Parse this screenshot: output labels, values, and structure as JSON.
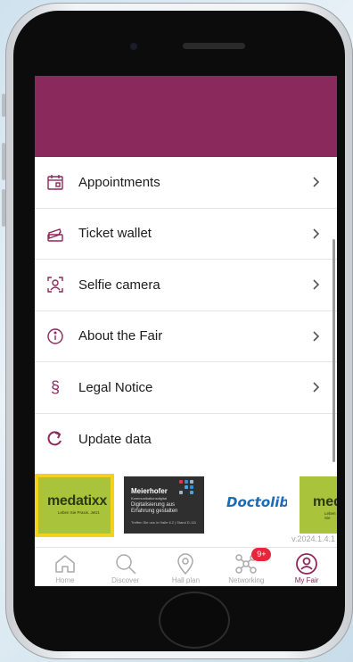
{
  "colors": {
    "brand": "#8a2a5c",
    "header": "#8a2a5c",
    "badge": "#e7253b",
    "sponsor_highlight": "#f2d21b",
    "inactive_tab": "#a9a9a9"
  },
  "menu": {
    "items": [
      {
        "label": "Appointments",
        "icon": "calendar-icon"
      },
      {
        "label": "Ticket wallet",
        "icon": "ticket-icon"
      },
      {
        "label": "Selfie camera",
        "icon": "selfie-camera-icon"
      },
      {
        "label": "About the Fair",
        "icon": "info-icon"
      },
      {
        "label": "Legal Notice",
        "icon": "section-sign-icon",
        "glyph": "§"
      },
      {
        "label": "Update data",
        "icon": "refresh-icon"
      }
    ]
  },
  "sponsors": [
    {
      "name": "medatixx",
      "tagline": "Leben Sie Praxis. Jetzt.",
      "selected": true
    },
    {
      "name": "Meierhofer",
      "line1": "Kommunikationsdigital",
      "line2": "Digitalisierung aus Erfahrung gestalten",
      "line3": "Treffen Sie uns in Halle 6.2 | Stand D-111"
    },
    {
      "name": "Doctolib"
    },
    {
      "name": "medatixx",
      "tagline": "Leben Sie"
    }
  ],
  "version": "v.2024.1.4.1",
  "tabbar": {
    "tabs": [
      {
        "label": "Home",
        "icon": "home-icon"
      },
      {
        "label": "Discover",
        "icon": "search-icon"
      },
      {
        "label": "Hall plan",
        "icon": "map-pin-icon"
      },
      {
        "label": "Networking",
        "icon": "network-icon",
        "badge": "9+"
      },
      {
        "label": "My Fair",
        "icon": "profile-icon",
        "active": true
      }
    ]
  }
}
